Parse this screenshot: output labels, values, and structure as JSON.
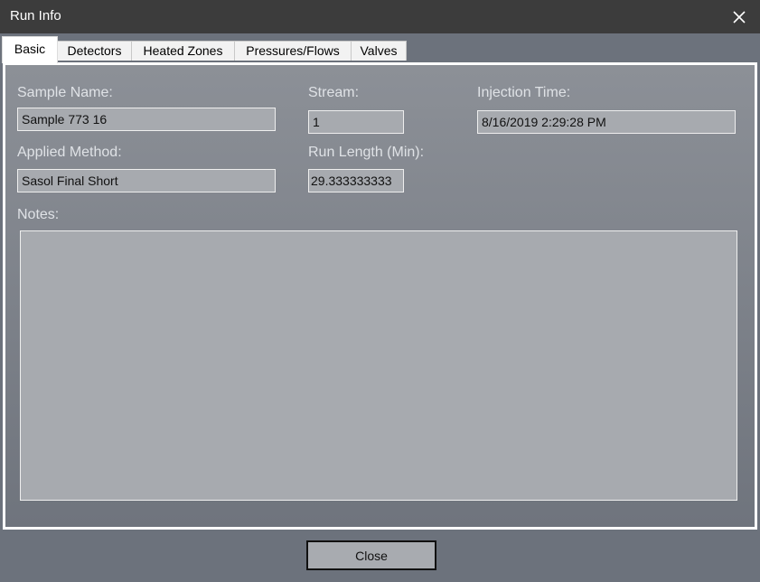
{
  "window": {
    "title": "Run Info",
    "close_icon": "close-icon"
  },
  "tabs": [
    {
      "label": "Basic",
      "active": true
    },
    {
      "label": "Detectors",
      "active": false
    },
    {
      "label": "Heated Zones",
      "active": false
    },
    {
      "label": "Pressures/Flows",
      "active": false
    },
    {
      "label": "Valves",
      "active": false
    }
  ],
  "basic": {
    "sample_name": {
      "label": "Sample Name:",
      "value": "Sample 773 16"
    },
    "stream": {
      "label": "Stream:",
      "value": "1"
    },
    "injection_time": {
      "label": "Injection Time:",
      "value": "8/16/2019 2:29:28 PM"
    },
    "applied_method": {
      "label": "Applied Method:",
      "value": "Sasol Final Short"
    },
    "run_length": {
      "label": "Run Length (Min):",
      "value": "29.333333333"
    },
    "notes": {
      "label": "Notes:",
      "value": ""
    }
  },
  "footer": {
    "close_label": "Close"
  },
  "colors": {
    "titlebar": "#3c3c3c",
    "background": "#6c727c",
    "field": "#a7aaaf",
    "label": "#dfe2e6"
  }
}
